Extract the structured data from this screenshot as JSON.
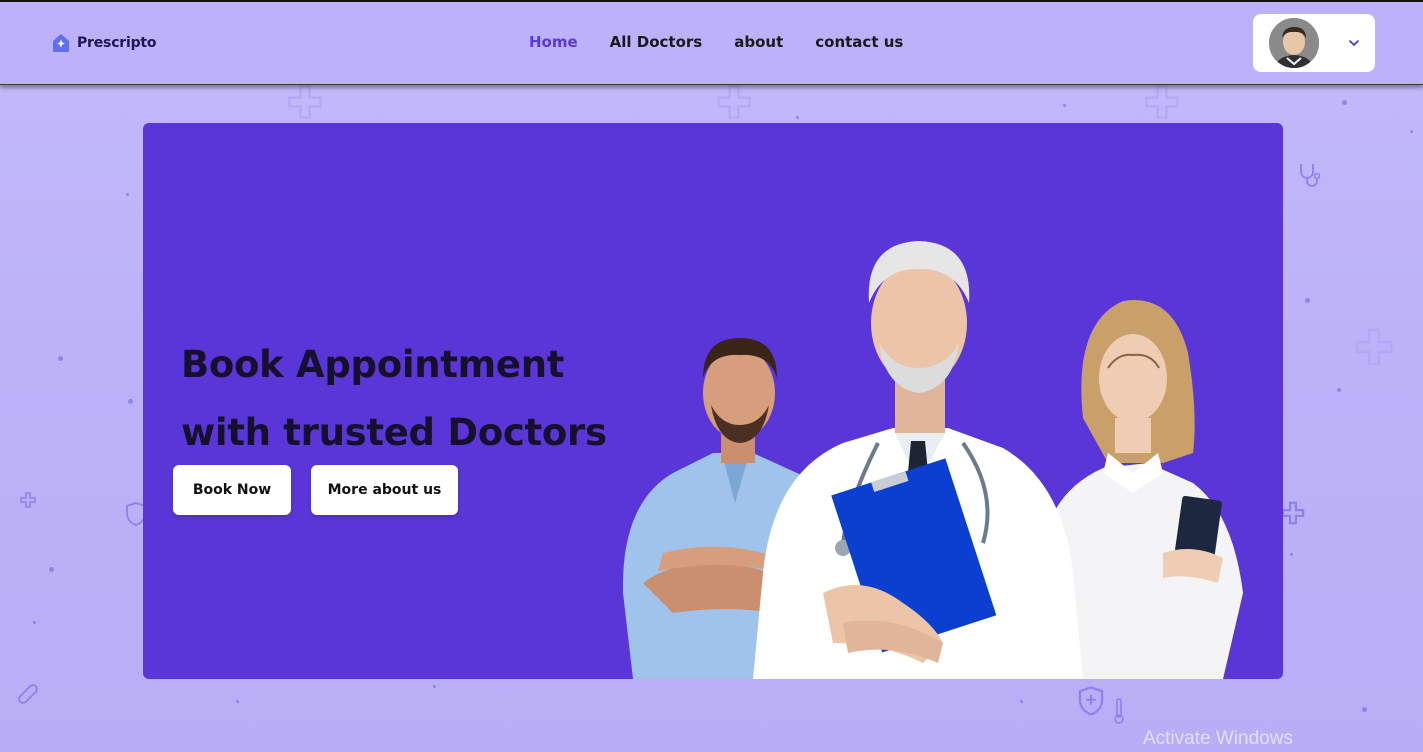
{
  "brand": {
    "name": "Prescripto"
  },
  "nav": {
    "items": [
      {
        "label": "Home",
        "active": true
      },
      {
        "label": "All Doctors",
        "active": false
      },
      {
        "label": "about",
        "active": false
      },
      {
        "label": "contact us",
        "active": false
      }
    ]
  },
  "profile": {
    "avatar_icon": "user-avatar",
    "menu_icon": "chevron-down-icon"
  },
  "hero": {
    "title_line1": "Book Appointment",
    "title_line2": "with trusted Doctors",
    "book_button": "Book Now",
    "more_button": "More about us"
  },
  "watermark": {
    "text": "Activate Windows"
  },
  "colors": {
    "accent": "#5b38d8",
    "hero_bg": "#5a36d8",
    "navbar_bg": "#bdb1fc",
    "page_bg": "#c3b9fb"
  }
}
